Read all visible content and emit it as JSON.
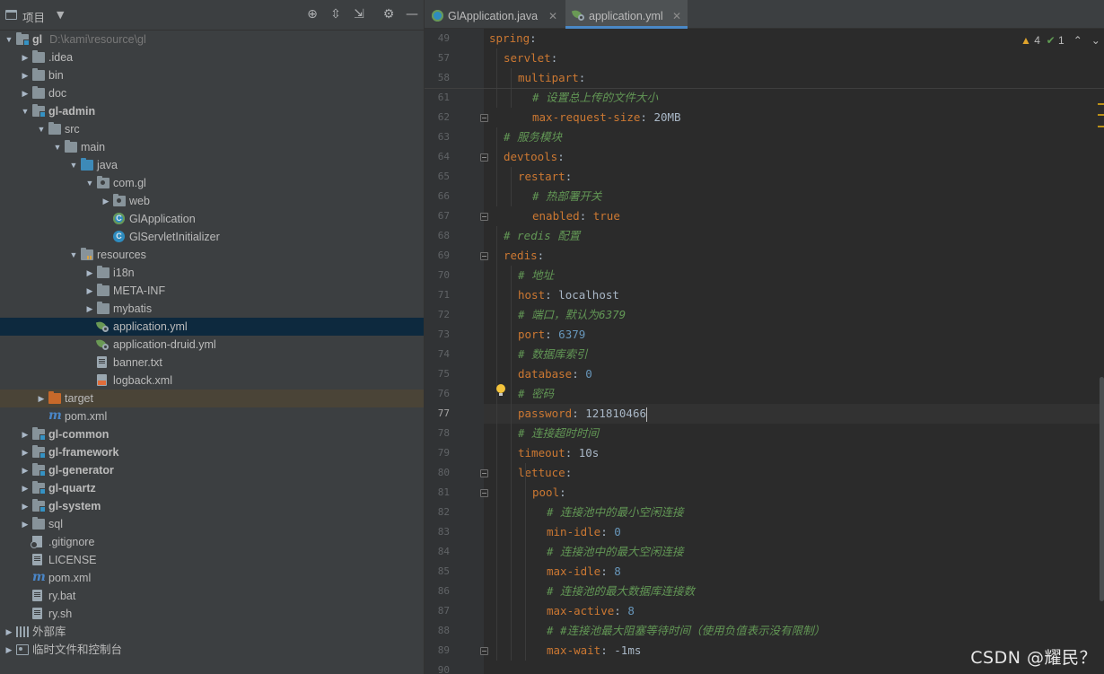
{
  "project_panel": {
    "title": "项目",
    "tree": [
      {
        "label": "gl",
        "hint": "D:\\kami\\resource\\gl",
        "depth": 0,
        "expanded": true,
        "icon": "module-folder-icon",
        "bold": true
      },
      {
        "label": ".idea",
        "depth": 1,
        "expanded": false,
        "icon": "folder-icon"
      },
      {
        "label": "bin",
        "depth": 1,
        "expanded": false,
        "icon": "folder-icon"
      },
      {
        "label": "doc",
        "depth": 1,
        "expanded": false,
        "icon": "folder-icon"
      },
      {
        "label": "gl-admin",
        "depth": 1,
        "expanded": true,
        "icon": "module-folder-icon",
        "bold": true
      },
      {
        "label": "src",
        "depth": 2,
        "expanded": true,
        "icon": "folder-icon"
      },
      {
        "label": "main",
        "depth": 3,
        "expanded": true,
        "icon": "folder-icon"
      },
      {
        "label": "java",
        "depth": 4,
        "expanded": true,
        "icon": "source-folder-icon"
      },
      {
        "label": "com.gl",
        "depth": 5,
        "expanded": true,
        "icon": "package-icon"
      },
      {
        "label": "web",
        "depth": 6,
        "expanded": false,
        "icon": "package-icon"
      },
      {
        "label": "GlApplication",
        "depth": 6,
        "icon": "spring-boot-class-icon"
      },
      {
        "label": "GlServletInitializer",
        "depth": 6,
        "icon": "class-icon"
      },
      {
        "label": "resources",
        "depth": 4,
        "expanded": true,
        "icon": "resources-folder-icon"
      },
      {
        "label": "i18n",
        "depth": 5,
        "expanded": false,
        "icon": "folder-icon"
      },
      {
        "label": "META-INF",
        "depth": 5,
        "expanded": false,
        "icon": "folder-icon"
      },
      {
        "label": "mybatis",
        "depth": 5,
        "expanded": false,
        "icon": "folder-icon"
      },
      {
        "label": "application.yml",
        "depth": 5,
        "icon": "spring-yml-icon",
        "selected": true
      },
      {
        "label": "application-druid.yml",
        "depth": 5,
        "icon": "spring-yml-icon"
      },
      {
        "label": "banner.txt",
        "depth": 5,
        "icon": "text-file-icon"
      },
      {
        "label": "logback.xml",
        "depth": 5,
        "icon": "xml-file-icon"
      },
      {
        "label": "target",
        "depth": 2,
        "expanded": false,
        "icon": "excluded-folder-icon",
        "excluded": true
      },
      {
        "label": "pom.xml",
        "depth": 2,
        "icon": "maven-icon"
      },
      {
        "label": "gl-common",
        "depth": 1,
        "expanded": false,
        "icon": "module-folder-icon",
        "bold": true
      },
      {
        "label": "gl-framework",
        "depth": 1,
        "expanded": false,
        "icon": "module-folder-icon",
        "bold": true
      },
      {
        "label": "gl-generator",
        "depth": 1,
        "expanded": false,
        "icon": "module-folder-icon",
        "bold": true
      },
      {
        "label": "gl-quartz",
        "depth": 1,
        "expanded": false,
        "icon": "module-folder-icon",
        "bold": true
      },
      {
        "label": "gl-system",
        "depth": 1,
        "expanded": false,
        "icon": "module-folder-icon",
        "bold": true
      },
      {
        "label": "sql",
        "depth": 1,
        "expanded": false,
        "icon": "folder-icon"
      },
      {
        "label": ".gitignore",
        "depth": 1,
        "icon": "gitignore-icon"
      },
      {
        "label": "LICENSE",
        "depth": 1,
        "icon": "text-file-icon"
      },
      {
        "label": "pom.xml",
        "depth": 1,
        "icon": "maven-icon"
      },
      {
        "label": "ry.bat",
        "depth": 1,
        "icon": "text-file-icon"
      },
      {
        "label": "ry.sh",
        "depth": 1,
        "icon": "text-file-icon"
      },
      {
        "label": "外部库",
        "depth": 0,
        "expanded": false,
        "icon": "libraries-icon"
      },
      {
        "label": "临时文件和控制台",
        "depth": 0,
        "expanded": false,
        "icon": "scratches-icon"
      }
    ]
  },
  "editor": {
    "tabs": [
      {
        "label": "GlApplication.java",
        "active": false
      },
      {
        "label": "application.yml",
        "active": true
      }
    ],
    "inspections": {
      "warnings": "4",
      "ok": "1"
    },
    "lines": [
      {
        "num": "49",
        "indent": 0,
        "tokens": [
          {
            "t": "k",
            "s": "spring"
          },
          {
            "t": "p",
            "s": ":"
          }
        ]
      },
      {
        "num": "57",
        "indent": 1,
        "tokens": [
          {
            "t": "k",
            "s": "servlet"
          },
          {
            "t": "p",
            "s": ":"
          }
        ]
      },
      {
        "num": "58",
        "indent": 2,
        "tokens": [
          {
            "t": "k",
            "s": "multipart"
          },
          {
            "t": "p",
            "s": ":"
          }
        ]
      },
      {
        "num": "61",
        "indent": 3,
        "tokens": [
          {
            "t": "c",
            "s": "# 设置总上传的文件大小"
          }
        ]
      },
      {
        "num": "62",
        "indent": 3,
        "tokens": [
          {
            "t": "k",
            "s": "max-request-size"
          },
          {
            "t": "p",
            "s": ": "
          },
          {
            "t": "v",
            "s": "20MB"
          }
        ]
      },
      {
        "num": "63",
        "indent": 1,
        "tokens": [
          {
            "t": "c",
            "s": "# 服务模块"
          }
        ]
      },
      {
        "num": "64",
        "indent": 1,
        "tokens": [
          {
            "t": "k",
            "s": "devtools"
          },
          {
            "t": "p",
            "s": ":"
          }
        ]
      },
      {
        "num": "65",
        "indent": 2,
        "tokens": [
          {
            "t": "k",
            "s": "restart"
          },
          {
            "t": "p",
            "s": ":"
          }
        ]
      },
      {
        "num": "66",
        "indent": 3,
        "tokens": [
          {
            "t": "c",
            "s": "# 热部署开关"
          }
        ]
      },
      {
        "num": "67",
        "indent": 3,
        "tokens": [
          {
            "t": "k",
            "s": "enabled"
          },
          {
            "t": "p",
            "s": ": "
          },
          {
            "t": "k",
            "s": "true"
          }
        ]
      },
      {
        "num": "68",
        "indent": 1,
        "tokens": [
          {
            "t": "c",
            "s": "# redis 配置"
          }
        ]
      },
      {
        "num": "69",
        "indent": 1,
        "tokens": [
          {
            "t": "k",
            "s": "redis"
          },
          {
            "t": "p",
            "s": ":"
          }
        ]
      },
      {
        "num": "70",
        "indent": 2,
        "tokens": [
          {
            "t": "c",
            "s": "# 地址"
          }
        ]
      },
      {
        "num": "71",
        "indent": 2,
        "tokens": [
          {
            "t": "k",
            "s": "host"
          },
          {
            "t": "p",
            "s": ": "
          },
          {
            "t": "v",
            "s": "localhost"
          }
        ]
      },
      {
        "num": "72",
        "indent": 2,
        "tokens": [
          {
            "t": "c",
            "s": "# 端口，默认为6379"
          }
        ]
      },
      {
        "num": "73",
        "indent": 2,
        "tokens": [
          {
            "t": "k",
            "s": "port"
          },
          {
            "t": "p",
            "s": ": "
          },
          {
            "t": "n",
            "s": "6379"
          }
        ]
      },
      {
        "num": "74",
        "indent": 2,
        "tokens": [
          {
            "t": "c",
            "s": "# 数据库索引"
          }
        ]
      },
      {
        "num": "75",
        "indent": 2,
        "tokens": [
          {
            "t": "k",
            "s": "database"
          },
          {
            "t": "p",
            "s": ": "
          },
          {
            "t": "n",
            "s": "0"
          }
        ]
      },
      {
        "num": "76",
        "indent": 2,
        "tokens": [
          {
            "t": "c",
            "s": "# 密码"
          }
        ]
      },
      {
        "num": "77",
        "indent": 2,
        "tokens": [
          {
            "t": "k",
            "s": "password"
          },
          {
            "t": "p",
            "s": ": "
          },
          {
            "t": "v",
            "s": "121810466"
          }
        ],
        "current": true
      },
      {
        "num": "78",
        "indent": 2,
        "tokens": [
          {
            "t": "c",
            "s": "# 连接超时时间"
          }
        ]
      },
      {
        "num": "79",
        "indent": 2,
        "tokens": [
          {
            "t": "k",
            "s": "timeout"
          },
          {
            "t": "p",
            "s": ": "
          },
          {
            "t": "v",
            "s": "10s"
          }
        ]
      },
      {
        "num": "80",
        "indent": 2,
        "tokens": [
          {
            "t": "k",
            "s": "lettuce"
          },
          {
            "t": "p",
            "s": ":"
          }
        ]
      },
      {
        "num": "81",
        "indent": 3,
        "tokens": [
          {
            "t": "k",
            "s": "pool"
          },
          {
            "t": "p",
            "s": ":"
          }
        ]
      },
      {
        "num": "82",
        "indent": 4,
        "tokens": [
          {
            "t": "c",
            "s": "# 连接池中的最小空闲连接"
          }
        ]
      },
      {
        "num": "83",
        "indent": 4,
        "tokens": [
          {
            "t": "k",
            "s": "min-idle"
          },
          {
            "t": "p",
            "s": ": "
          },
          {
            "t": "n",
            "s": "0"
          }
        ]
      },
      {
        "num": "84",
        "indent": 4,
        "tokens": [
          {
            "t": "c",
            "s": "# 连接池中的最大空闲连接"
          }
        ]
      },
      {
        "num": "85",
        "indent": 4,
        "tokens": [
          {
            "t": "k",
            "s": "max-idle"
          },
          {
            "t": "p",
            "s": ": "
          },
          {
            "t": "n",
            "s": "8"
          }
        ]
      },
      {
        "num": "86",
        "indent": 4,
        "tokens": [
          {
            "t": "c",
            "s": "# 连接池的最大数据库连接数"
          }
        ]
      },
      {
        "num": "87",
        "indent": 4,
        "tokens": [
          {
            "t": "k",
            "s": "max-active"
          },
          {
            "t": "p",
            "s": ": "
          },
          {
            "t": "n",
            "s": "8"
          }
        ]
      },
      {
        "num": "88",
        "indent": 4,
        "tokens": [
          {
            "t": "c",
            "s": "# #连接池最大阻塞等待时间（使用负值表示没有限制）"
          }
        ]
      },
      {
        "num": "89",
        "indent": 4,
        "tokens": [
          {
            "t": "k",
            "s": "max-wait"
          },
          {
            "t": "p",
            "s": ": "
          },
          {
            "t": "v",
            "s": "-1ms"
          }
        ]
      },
      {
        "num": "90",
        "indent": 0,
        "tokens": []
      }
    ]
  },
  "watermark": "CSDN @耀民？"
}
